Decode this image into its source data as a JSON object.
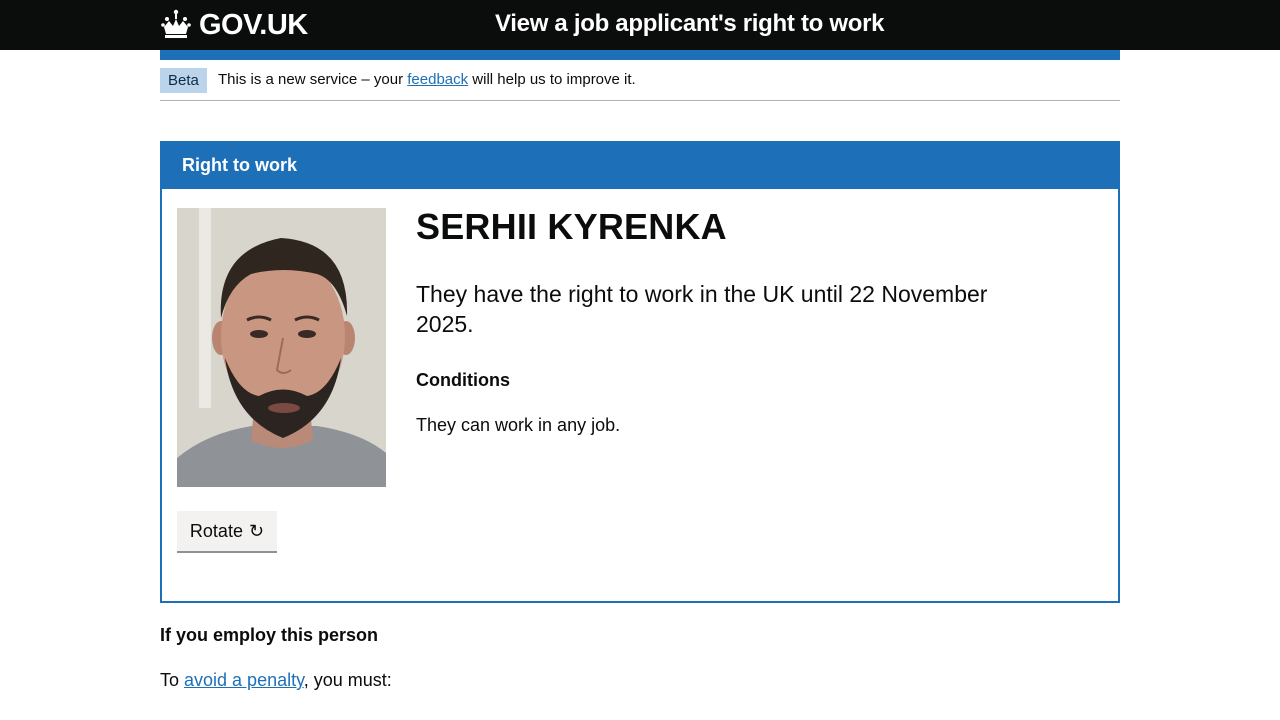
{
  "header": {
    "logo_text": "GOV.UK",
    "service_name": "View a job applicant's right to work"
  },
  "phase_banner": {
    "tag": "Beta",
    "text_before": "This is a new service – your ",
    "link": "feedback",
    "text_after": " will help us to improve it."
  },
  "panel": {
    "title": "Right to work",
    "name": "SERHII KYRENKA",
    "statement": "They have the right to work in the UK until 22 November 2025.",
    "conditions_heading": "Conditions",
    "conditions_text": "They can work in any job.",
    "rotate_label": "Rotate",
    "rotate_icon": "↻"
  },
  "employ": {
    "heading": "If you employ this person",
    "penalty_before": "To ",
    "penalty_link": "avoid a penalty",
    "penalty_after": ", you must:"
  },
  "colors": {
    "header_bg": "#0b0c0c",
    "brand_blue": "#1d70b8",
    "tag_bg": "#bbd4ea",
    "button_bg": "#f3f2f1"
  }
}
